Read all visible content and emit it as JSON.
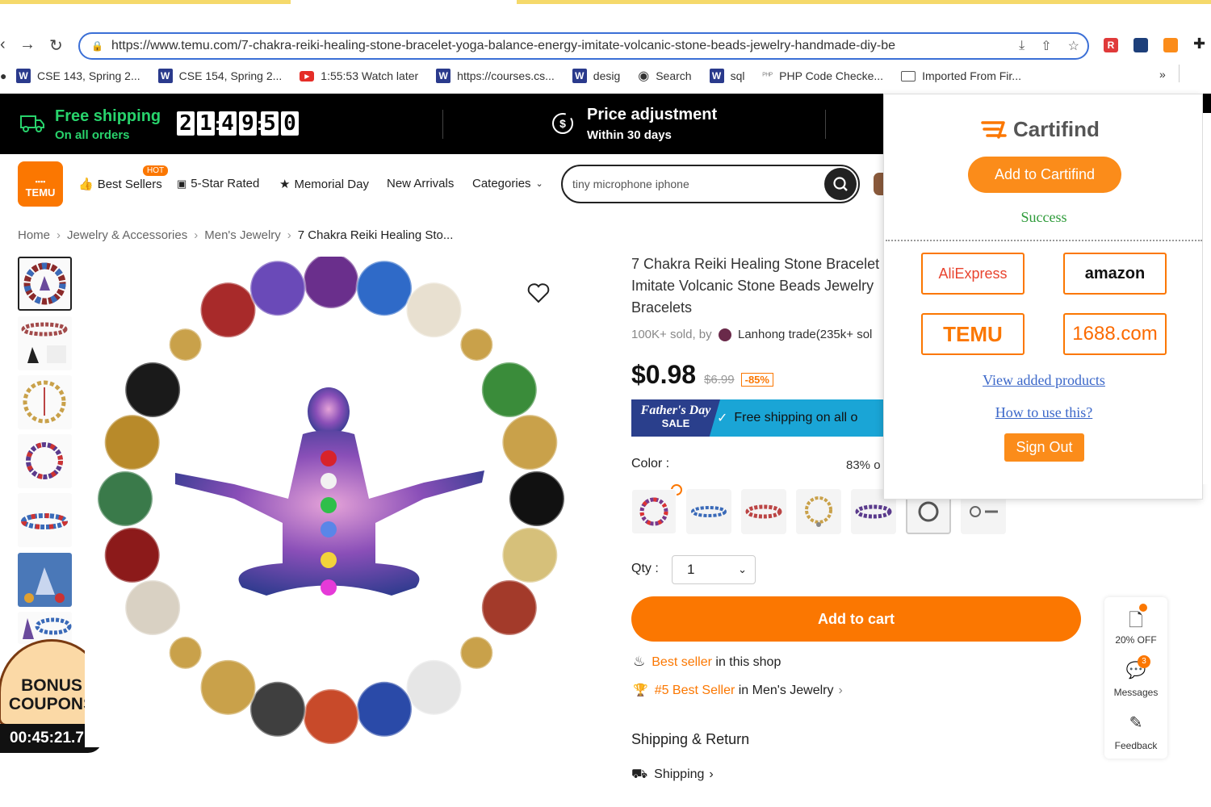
{
  "browser": {
    "url": "https://www.temu.com/7-chakra-reiki-healing-stone-bracelet-yoga-balance-energy-imitate-volcanic-stone-beads-jewelry-handmade-diy-be",
    "bookmarks": [
      {
        "icon": "w-icon",
        "label": "CSE 143, Spring 2..."
      },
      {
        "icon": "w-icon",
        "label": "CSE 154, Spring 2..."
      },
      {
        "icon": "youtube-icon",
        "label": "1:55:53 Watch later"
      },
      {
        "icon": "w-icon",
        "label": "https://courses.cs..."
      },
      {
        "icon": "w-icon",
        "label": "desig"
      },
      {
        "icon": "globe-icon",
        "label": "Search"
      },
      {
        "icon": "w-icon",
        "label": "sql"
      },
      {
        "icon": "php-icon",
        "label": "PHP Code Checke..."
      },
      {
        "icon": "folder-icon",
        "label": "Imported From Fir..."
      }
    ],
    "bookmarks_more": "»"
  },
  "promo": {
    "shipping_title": "Free shipping",
    "shipping_sub": "On all orders",
    "countdown": [
      "2",
      "1",
      "4",
      "9",
      "5",
      "0"
    ],
    "price_adj_title": "Price adjustment",
    "price_adj_sub": "Within 30 days"
  },
  "header": {
    "logo": "TEMU",
    "nav": {
      "best_sellers": "Best Sellers",
      "hot_badge": "HOT",
      "five_star": "5-Star Rated",
      "memorial": "Memorial Day",
      "new_arrivals": "New Arrivals",
      "categories": "Categories"
    },
    "search_value": "tiny microphone iphone"
  },
  "breadcrumb": {
    "home": "Home",
    "jewelry": "Jewelry & Accessories",
    "mens": "Men's Jewelry",
    "current": "7 Chakra Reiki Healing Sto..."
  },
  "product": {
    "title": "7 Chakra Reiki Healing Stone Bracelet Imitate Volcanic Stone Beads Jewelry Bracelets",
    "sold_prefix": "100K+ sold, by",
    "seller": "Lanhong trade(235k+ sol",
    "price": "$0.98",
    "old_price": "$6.99",
    "discount": "-85%",
    "banner_event_line1": "Father's Day",
    "banner_event_line2": "SALE",
    "banner_text": "Free shipping on all o",
    "color_label": "Color :",
    "color_percent": "83% o",
    "qty_label": "Qty :",
    "qty_value": "1",
    "add_to_cart": "Add to cart",
    "best_seller_highlight": "Best seller",
    "best_seller_rest": " in this shop",
    "rank_highlight": "#5 Best Seller",
    "rank_rest": " in Men's Jewelry",
    "shipping_return": "Shipping & Return",
    "shipping": "Shipping"
  },
  "coupon": {
    "line1": "BONUS",
    "line2": "COUPONS",
    "timer": "00:45:21.7"
  },
  "cartifind": {
    "brand": "Cartifind",
    "add_button": "Add to Cartifind",
    "status": "Success",
    "stores": [
      "AliExpress",
      "amazon",
      "TEMU",
      "1688.com"
    ],
    "view_link": "View added products",
    "howto_link": "How to use this?",
    "signout": "Sign Out"
  },
  "side": {
    "off": "20% OFF",
    "messages": "Messages",
    "messages_badge": "3",
    "feedback": "Feedback"
  },
  "colors": {
    "accent": "#fb7701",
    "success": "#2e9b3a",
    "link": "#3b67c9",
    "banner": "#1aa5d6"
  }
}
